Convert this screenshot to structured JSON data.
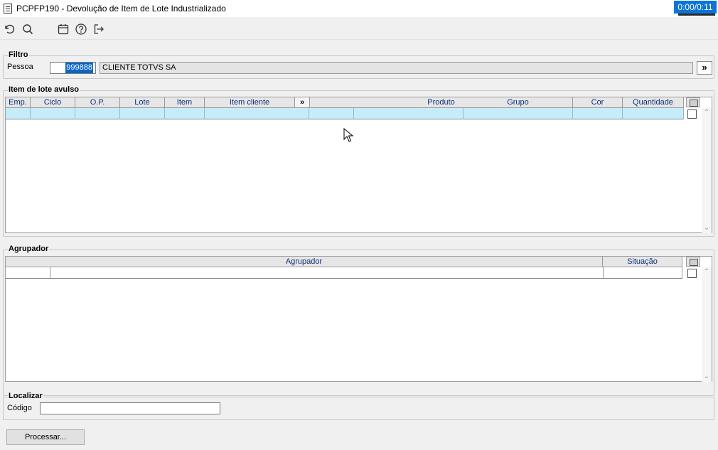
{
  "window": {
    "title": "PCPFP190 - Devolução de Item de Lote Industrializado",
    "timer": "0:00/0:11"
  },
  "toolbar": {
    "icons": [
      "undo-icon",
      "search-icon",
      "calendar-icon",
      "help-icon",
      "exit-icon"
    ]
  },
  "filtro": {
    "legend": "Filtro",
    "pessoa_label": "Pessoa",
    "pessoa_value": "999888",
    "pessoa_name": "CLIENTE TOTVS SA",
    "more_label": "»"
  },
  "item_lote": {
    "legend": "Item de lote avulso",
    "columns": [
      "Emp.",
      "Ciclo",
      "O.P.",
      "Lote",
      "Item",
      "Item cliente",
      "»",
      "Produto",
      "Grupo",
      "Cor",
      "Quantidade"
    ]
  },
  "agrupador": {
    "legend": "Agrupador",
    "columns": [
      "Agrupador",
      "Situação"
    ]
  },
  "localizar": {
    "legend": "Localizar",
    "codigo_label": "Código",
    "codigo_value": ""
  },
  "actions": {
    "processar_label": "Processar..."
  },
  "colors": {
    "header_text": "#0b2f7d",
    "selected_row": "#c6ecf9",
    "timer_bg": "#0c74d4"
  }
}
